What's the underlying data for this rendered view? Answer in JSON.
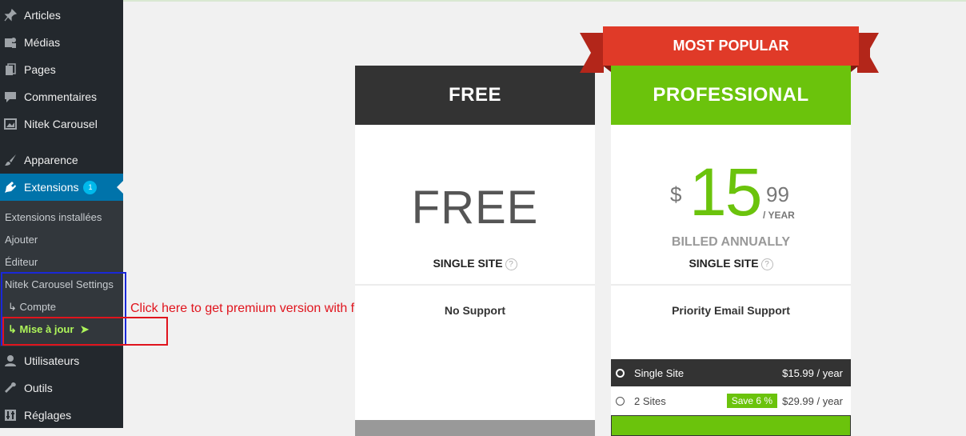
{
  "sidebar": {
    "items": [
      {
        "label": "Articles",
        "icon": "pin-icon"
      },
      {
        "label": "Médias",
        "icon": "media-icon"
      },
      {
        "label": "Pages",
        "icon": "pages-icon"
      },
      {
        "label": "Commentaires",
        "icon": "comment-icon"
      },
      {
        "label": "Nitek Carousel",
        "icon": "carousel-icon"
      },
      {
        "label": "Apparence",
        "icon": "brush-icon"
      },
      {
        "label": "Extensions",
        "icon": "plugin-icon",
        "badge": "1"
      },
      {
        "label": "Utilisateurs",
        "icon": "user-icon"
      },
      {
        "label": "Outils",
        "icon": "wrench-icon"
      },
      {
        "label": "Réglages",
        "icon": "settings-icon"
      }
    ],
    "submenu": [
      "Extensions installées",
      "Ajouter",
      "Éditeur",
      "Nitek Carousel Settings",
      "↳ Compte",
      "↳ Mise à jour"
    ]
  },
  "annotation": "Click here to get premium version with full options",
  "colors": {
    "green": "#6bc30c",
    "red": "#e03a28",
    "dark": "#333333",
    "wp_blue": "#0073aa",
    "annotation_red": "#e0141d",
    "annotation_blue": "#1a28d8"
  },
  "free_plan": {
    "title": "FREE",
    "price": "FREE",
    "sites": "SINGLE SITE",
    "help": "?",
    "support": "No Support"
  },
  "pro_plan": {
    "ribbon": "MOST POPULAR",
    "title": "PROFESSIONAL",
    "currency": "$",
    "price_int": "15",
    "price_cents": "99",
    "per": "/ YEAR",
    "billed": "BILLED ANNUALLY",
    "sites": "SINGLE SITE",
    "help": "?",
    "support": "Priority Email Support",
    "options": [
      {
        "name": "Single Site",
        "price": "$15.99 / year",
        "selected": true
      },
      {
        "name": "2 Sites",
        "price": "$29.99 / year",
        "save": "Save 6 %",
        "selected": false
      }
    ]
  }
}
